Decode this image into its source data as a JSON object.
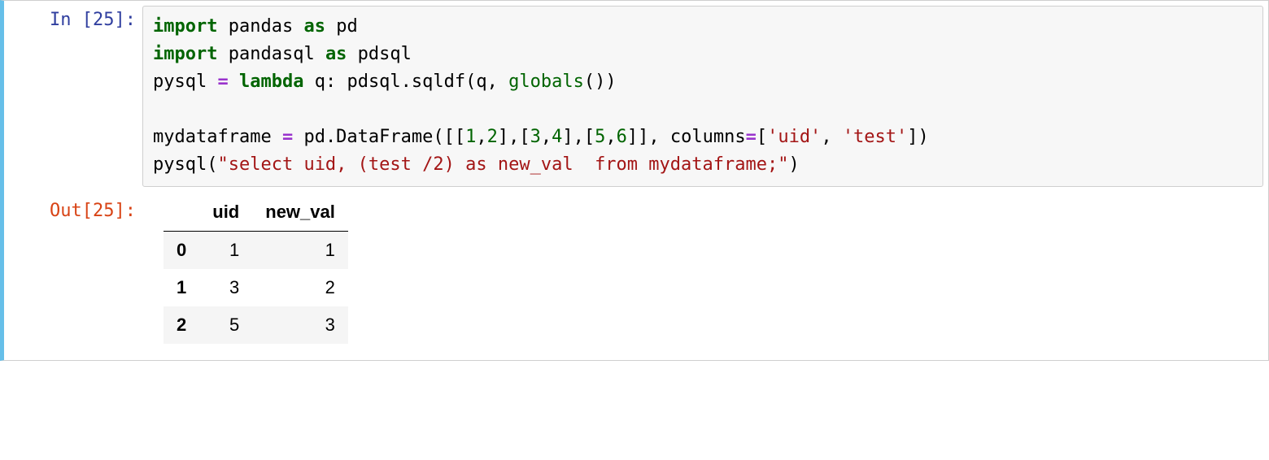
{
  "in_prompt": "In [25]:",
  "out_prompt": "Out[25]:",
  "code": {
    "l1_import": "import",
    "l1_pkg": " pandas ",
    "l1_as": "as",
    "l1_alias": " pd",
    "l2_import": "import",
    "l2_pkg": " pandasql ",
    "l2_as": "as",
    "l2_alias": " pdsql",
    "l3_lhs": "pysql ",
    "l3_eq": "=",
    "l3_sp1": " ",
    "l3_lambda": "lambda",
    "l3_after_lambda": " q: pdsql.sqldf(q, ",
    "l3_globals": "globals",
    "l3_tail": "())",
    "l4_blank": "",
    "l5_lhs": "mydataframe ",
    "l5_eq": "=",
    "l5_a": " pd.DataFrame([[",
    "l5_n1": "1",
    "l5_c1": ",",
    "l5_n2": "2",
    "l5_b": "],[",
    "l5_n3": "3",
    "l5_c2": ",",
    "l5_n4": "4",
    "l5_c": "],[",
    "l5_n5": "5",
    "l5_c3": ",",
    "l5_n6": "6",
    "l5_d": "]], columns",
    "l5_eq2": "=",
    "l5_e": "[",
    "l5_s1": "'uid'",
    "l5_f": ", ",
    "l5_s2": "'test'",
    "l5_g": "])",
    "l6_call": "pysql(",
    "l6_str": "\"select uid, (test /2) as new_val  from mydataframe;\"",
    "l6_close": ")"
  },
  "table": {
    "columns": [
      "uid",
      "new_val"
    ],
    "index": [
      "0",
      "1",
      "2"
    ],
    "rows": [
      [
        "1",
        "1"
      ],
      [
        "3",
        "2"
      ],
      [
        "5",
        "3"
      ]
    ]
  }
}
